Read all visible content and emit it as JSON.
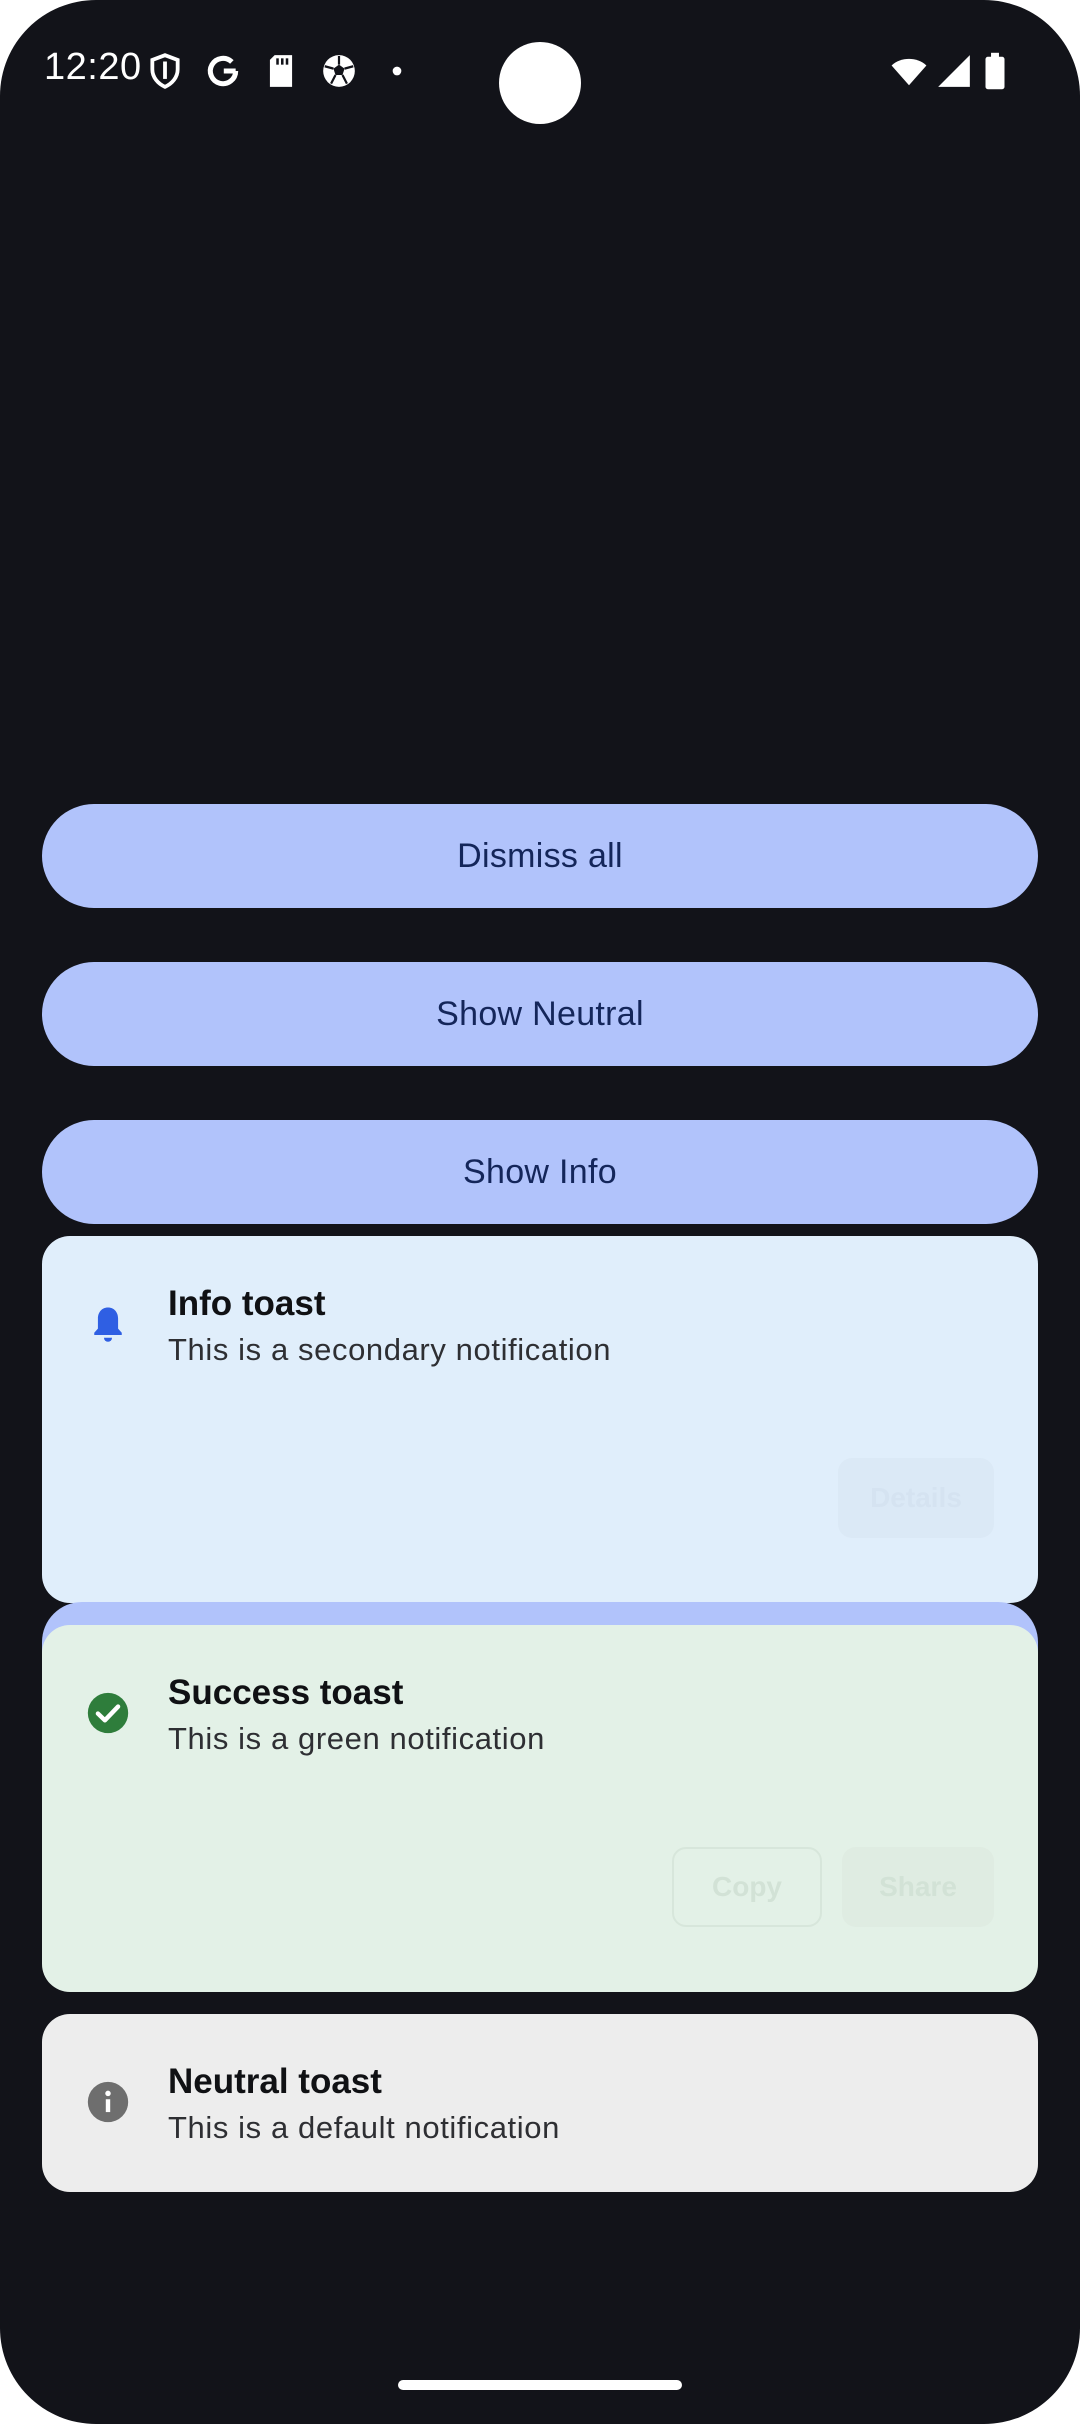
{
  "status_bar": {
    "time": "12:20",
    "left_icons": [
      "shield-icon",
      "google-icon",
      "sd-card-icon",
      "soccer-ball-icon",
      "dot-icon"
    ],
    "right_icons": [
      "wifi-icon",
      "cellular-signal-icon",
      "battery-icon"
    ]
  },
  "buttons": {
    "dismiss_all": "Dismiss all",
    "show_neutral": "Show Neutral",
    "show_info": "Show Info"
  },
  "toasts": {
    "info": {
      "icon": "bell-icon",
      "title": "Info toast",
      "body": "This is a secondary notification",
      "actions": [
        "Details"
      ],
      "color": "#e0eefb",
      "icon_color": "#2f5fe3"
    },
    "success": {
      "icon": "check-circle-icon",
      "title": "Success toast",
      "body": "This is a green notification",
      "actions": [
        "Copy",
        "Share"
      ],
      "color": "#e3f1e7",
      "icon_color": "#2e7d3b"
    },
    "neutral": {
      "icon": "info-circle-icon",
      "title": "Neutral toast",
      "body": "This is a default notification",
      "color": "#ededed",
      "icon_color": "#6e6e6e"
    }
  },
  "colors": {
    "background": "#121319",
    "button_fill": "#b1c3fb",
    "button_text": "#14265a"
  }
}
